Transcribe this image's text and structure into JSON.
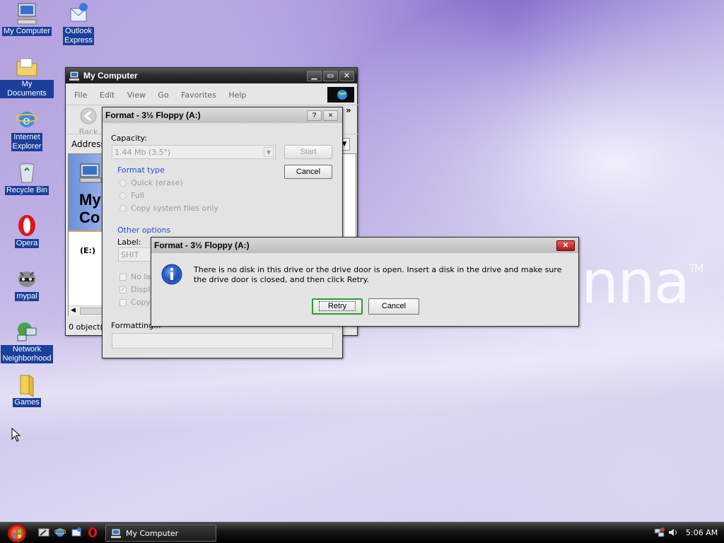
{
  "desktop_icons": [
    {
      "label": "My Computer",
      "icon": "my-computer-icon"
    },
    {
      "label": "Outlook Express",
      "icon": "outlook-express-icon"
    },
    {
      "label": "My Documents",
      "icon": "my-documents-icon"
    },
    {
      "label": "Internet Explorer",
      "icon": "internet-explorer-icon"
    },
    {
      "label": "Recycle Bin",
      "icon": "recycle-bin-icon"
    },
    {
      "label": "Opera",
      "icon": "opera-icon"
    },
    {
      "label": "mypal",
      "icon": "mypal-icon"
    },
    {
      "label": "Network Neighborhood",
      "icon": "network-neighborhood-icon"
    },
    {
      "label": "Games",
      "icon": "games-folder-icon"
    }
  ],
  "wallpaper": {
    "brand": "nna",
    "tm": "TM"
  },
  "my_computer_window": {
    "title": "My Computer",
    "menu": [
      "File",
      "Edit",
      "View",
      "Go",
      "Favorites",
      "Help"
    ],
    "back_label": "Back",
    "address_label": "Address",
    "chevron": "»",
    "content_title_line1": "My",
    "content_title_line2": "Co",
    "drive_label": "(E:)",
    "status": "0 object(s"
  },
  "format_dialog": {
    "title": "Format - 3½ Floppy (A:)",
    "help_btn": "?",
    "close_btn": "×",
    "capacity_label": "Capacity:",
    "capacity_value": "1.44 Mb (3.5\")",
    "start_label": "Start",
    "cancel_label": "Cancel",
    "format_type_label": "Format type",
    "format_types": [
      "Quick (erase)",
      "Full",
      "Copy system files only"
    ],
    "other_options_label": "Other options",
    "label_label": "Label:",
    "label_value": "SHIT",
    "other_checks": [
      "No lab",
      "Displa",
      "Copy"
    ],
    "formatting_label": "Formatting..."
  },
  "error_dialog": {
    "title": "Format - 3½ Floppy (A:)",
    "message": "There is no disk in this drive or the drive door is open. Insert a disk in the drive and make sure the drive door is closed, and then click Retry.",
    "retry_label": "Retry",
    "cancel_label": "Cancel"
  },
  "taskbar": {
    "task_label": "My Computer",
    "clock": "5:06 AM",
    "quicklaunch": [
      "show-desktop-icon",
      "internet-explorer-icon",
      "outlook-express-icon",
      "opera-icon"
    ]
  },
  "colors": {
    "accent": "#2250c8",
    "title_dark": "#1c1c1c",
    "focus_green": "#2f9a33"
  }
}
